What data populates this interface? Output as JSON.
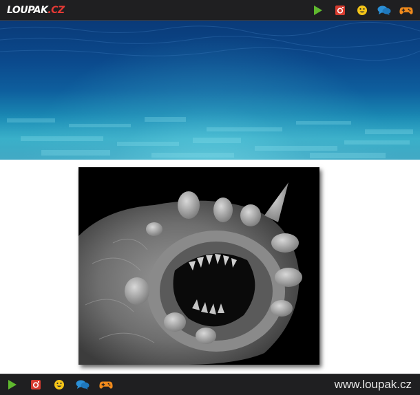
{
  "header": {
    "logo_main": "LOUPAK",
    "logo_suffix": ".CZ",
    "icons": [
      "play-icon",
      "instagram-icon",
      "smiley-icon",
      "chat-icon",
      "gamepad-icon"
    ]
  },
  "banner": {
    "description_icon": "underwater-banner-image"
  },
  "photo": {
    "icon": "worm-mouth-microscope-photo"
  },
  "footer": {
    "icons": [
      "play-icon",
      "instagram-icon",
      "smiley-icon",
      "chat-icon",
      "gamepad-icon"
    ],
    "site": "www.loupak.cz"
  },
  "colors": {
    "bar_bg": "#1f1f21",
    "play": "#5fb82e",
    "instagram": "#d63b2f",
    "smiley": "#f5c518",
    "chat": "#2b8fd6",
    "gamepad": "#f08a1c",
    "logo_accent": "#e53935"
  }
}
